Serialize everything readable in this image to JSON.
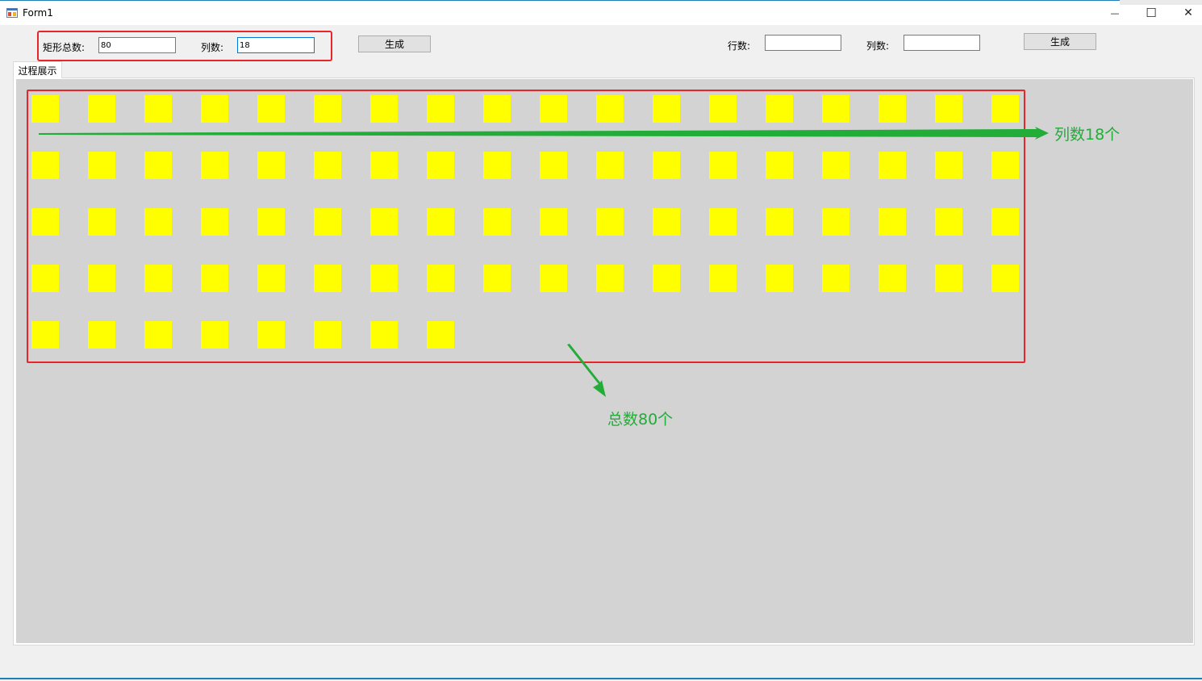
{
  "window": {
    "title": "Form1",
    "minimize_glyph": "—",
    "maximize_glyph": "☐",
    "close_glyph": "✕",
    "icon": "form-app-icon"
  },
  "toolbar_left": {
    "total_label": "矩形总数:",
    "total_value": "80",
    "cols_label": "列数:",
    "cols_value": "18",
    "generate_label": "生成"
  },
  "toolbar_right": {
    "rows_label": "行数:",
    "rows_value": "",
    "cols_label": "列数:",
    "cols_value": "",
    "generate_label": "生成"
  },
  "tab": {
    "label": "过程展示"
  },
  "grid": {
    "total": 80,
    "columns": 18,
    "rect_color": "#ffff00",
    "panel_color": "#d3d3d3"
  },
  "annotations": {
    "columns_note": "列数18个",
    "total_note": "总数80个",
    "highlight_color": "#e8262a",
    "arrow_color": "#22ac38"
  }
}
